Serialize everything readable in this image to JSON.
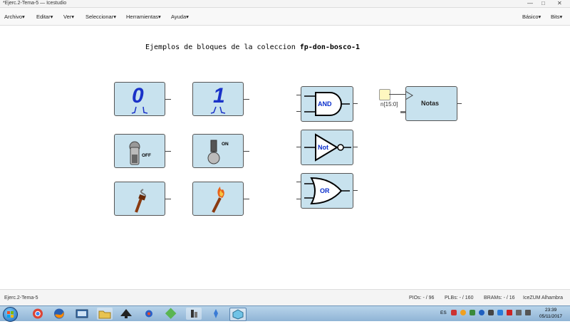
{
  "window": {
    "title": "*Ejerc.2-Tema-5 — Icestudio",
    "controls": [
      "—",
      "□",
      "✕"
    ]
  },
  "menu": {
    "left": [
      "Archivo",
      "Editar",
      "Ver",
      "Seleccionar",
      "Herramientas",
      "Ayuda"
    ],
    "right": [
      "Básico",
      "Bits"
    ]
  },
  "canvas": {
    "heading_text": "Ejemplos de bloques de la coleccion ",
    "heading_bold": "fp-don-bosco-1",
    "blocks": {
      "zero": "0",
      "one": "1",
      "off": "OFF",
      "on": "ON",
      "and": "AND",
      "not": "Not",
      "or": "OR",
      "notes": "Notas",
      "bus_label": "n[15:0]"
    }
  },
  "status": {
    "project": "Ejerc.2-Tema-5",
    "pios": "PIOs: - / 96",
    "plbs": "PLBs: - / 160",
    "brams": "BRAMs: - / 16",
    "board": "IceZUM Alhambra"
  },
  "taskbar": {
    "lang": "ES",
    "time": "23:39",
    "date": "05/11/2017"
  },
  "colors": {
    "block_fill": "#c8e2ee",
    "gate_text": "#0a2ecc",
    "digit": "#1a32c8",
    "torch_flame": "#e8621a"
  }
}
